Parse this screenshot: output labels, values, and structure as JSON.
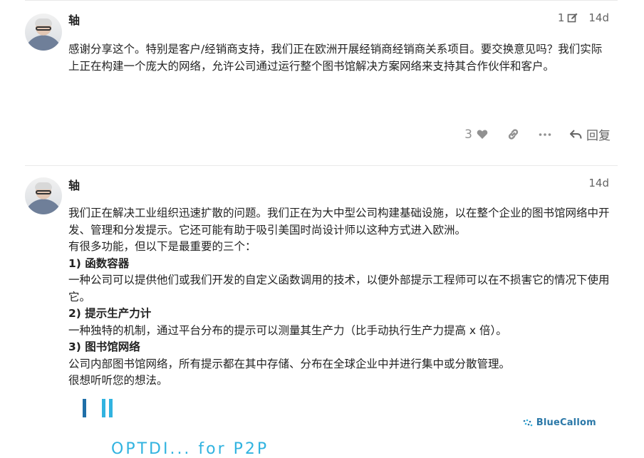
{
  "posts": [
    {
      "username": "轴",
      "edit_count": "1",
      "age": "14d",
      "paragraphs": [
        "感谢分享这个。特别是客户/经销商支持，我们正在欧洲开展经销商经销商关系项目。要交换意见吗？我们实际上正在构建一个庞大的网络，允许公司通过运行整个图书馆解决方案网络来支持其合作伙伴和客户。"
      ],
      "actions": {
        "like_count": "3",
        "reply_label": "回复"
      }
    },
    {
      "username": "轴",
      "age": "14d",
      "lines": {
        "p1": "我们正在解决工业组织迅速扩散的问题。我们正在为大中型公司构建基础设施，以在整个企业的图书馆网络中开发、管理和分发提示。它还可能有助于吸引美国时尚设计师以这种方式进入欧洲。",
        "p2": "有很多功能，但以下是最重要的三个：",
        "h1": "1) 函数容器",
        "d1": "一种公司可以提供他们或我们开发的自定义函数调用的技术，以便外部提示工程师可以在不损害它的情况下使用它。",
        "h2": "2) 提示生产力计",
        "d2": "一种独特的机制，通过平台分布的提示可以测量其生产力（比手动执行生产力提高 x 倍）。",
        "h3": "3) 图书馆网络",
        "d3": "公司内部图书馆网络，所有提示都在其中存储、分布在全球企业中并进行集中或分散管理。",
        "p3": "很想听听您的想法。"
      },
      "embedded_image": {
        "brand": "BlueCallom",
        "partial_text": "OPTDI... for P2P"
      }
    }
  ],
  "colors": {
    "accent": "#2b78a8",
    "bar_dark": "#1f6fa8",
    "bar_light": "#31b3e0",
    "muted": "#919191"
  }
}
